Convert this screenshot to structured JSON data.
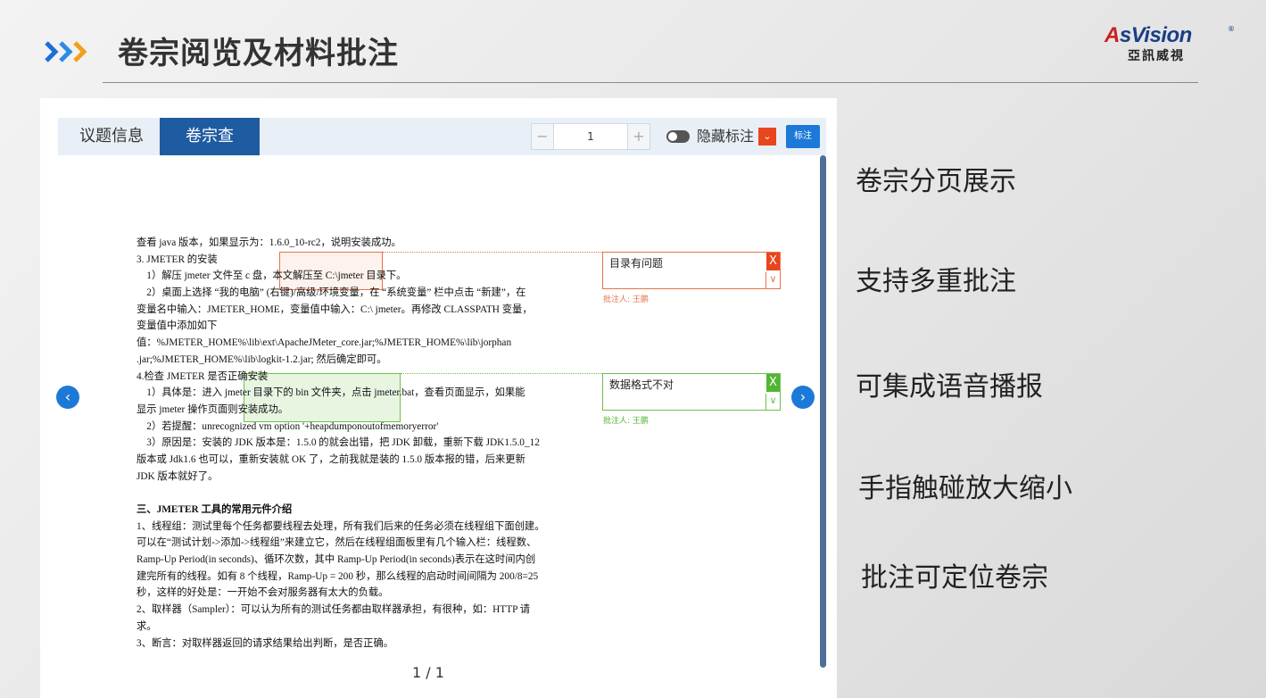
{
  "header": {
    "title": "卷宗阅览及材料批注",
    "logo": {
      "brand": "AsVision",
      "brand_initial": "A",
      "brand_rest": "sVision",
      "registered": "®",
      "chinese": "亞訊威視"
    }
  },
  "viewer": {
    "tabs": [
      {
        "label": "议题信息",
        "active": false
      },
      {
        "label": "卷宗查看",
        "active": true
      }
    ],
    "toolbar": {
      "minus": "−",
      "page_value": "1",
      "plus": "+",
      "toggle_label": "隐藏标注",
      "color_picker": "⌄",
      "mark_button": "标注"
    },
    "document_lines": [
      "查看 java 版本，如果显示为：1.6.0_10-rc2，说明安装成功。",
      "3. JMETER 的安装",
      "　1）解压 jmeter 文件至 c 盘，本文解压至 C:\\jmeter 目录下。",
      "　2）桌面上选择 “我的电脑” (右键)/高级/环境变量，在 “系统变量” 栏中点击 “新建”，在",
      "变量名中输入：JMETER_HOME，变量值中输入：C:\\ jmeter。再修改 CLASSPATH 变量，",
      "变量值中添加如下",
      "值：%JMETER_HOME%\\lib\\ext\\ApacheJMeter_core.jar;%JMETER_HOME%\\lib\\jorphan",
      ".jar;%JMETER_HOME%\\lib\\logkit-1.2.jar; 然后确定即可。",
      "4.检查 JMETER 是否正确安装",
      "　1）具体是：进入 jmeter 目录下的 bin 文件夹，点击 jmeter.bat，查看页面显示，如果能",
      "显示 jmeter 操作页面则安装成功。",
      "　2）若提醒：unrecognized vm option '+heapdumponoutofmemoryerror'",
      "　3）原因是：安装的 JDK 版本是：1.5.0 的就会出错，把 JDK 卸载，重新下载 JDK1.5.0_12",
      "版本或 Jdk1.6 也可以，重新安装就 OK 了，之前我就是装的 1.5.0 版本报的错，后来更新",
      "JDK 版本就好了。"
    ],
    "section_heading": "三、JMETER 工具的常用元件介绍",
    "section_lines": [
      "1、线程组：测试里每个任务都要线程去处理，所有我们后来的任务必须在线程组下面创建。",
      "可以在“测试计划->添加->线程组”来建立它，然后在线程组面板里有几个输入栏：线程数、",
      "Ramp-Up Period(in seconds)、循环次数，其中 Ramp-Up Period(in seconds)表示在这时间内创",
      "建完所有的线程。如有 8 个线程，Ramp-Up = 200 秒，那么线程的启动时间间隔为 200/8=25",
      "秒，这样的好处是：一开始不会对服务器有太大的负载。",
      "2、取样器（Sampler）：可以认为所有的测试任务都由取样器承担，有很种，如：HTTP 请",
      "求。",
      "3、断言：对取样器返回的请求结果给出判断，是否正确。"
    ],
    "annotations": [
      {
        "text": "目录有问题",
        "author": "批注人: 王鹏",
        "color": "#e8461d",
        "close": "X",
        "expand": "∨"
      },
      {
        "text": "数据格式不对",
        "author": "批注人: 王鹏",
        "color": "#52b534",
        "close": "X",
        "expand": "∨"
      }
    ],
    "nav": {
      "prev": "‹",
      "next": "›",
      "prev_icon": "chevron-left-icon",
      "next_icon": "chevron-right-icon"
    },
    "pager": "1 / 1"
  },
  "features": [
    "卷宗分页展示",
    "支持多重批注",
    "可集成语音播报",
    "手指触碰放大缩小",
    "批注可定位卷宗"
  ],
  "colors": {
    "accent_blue": "#1f5ba0",
    "chevron_blue": "#1c6fd6",
    "logo_red": "#c8211e",
    "logo_blue": "#1a3e86"
  }
}
